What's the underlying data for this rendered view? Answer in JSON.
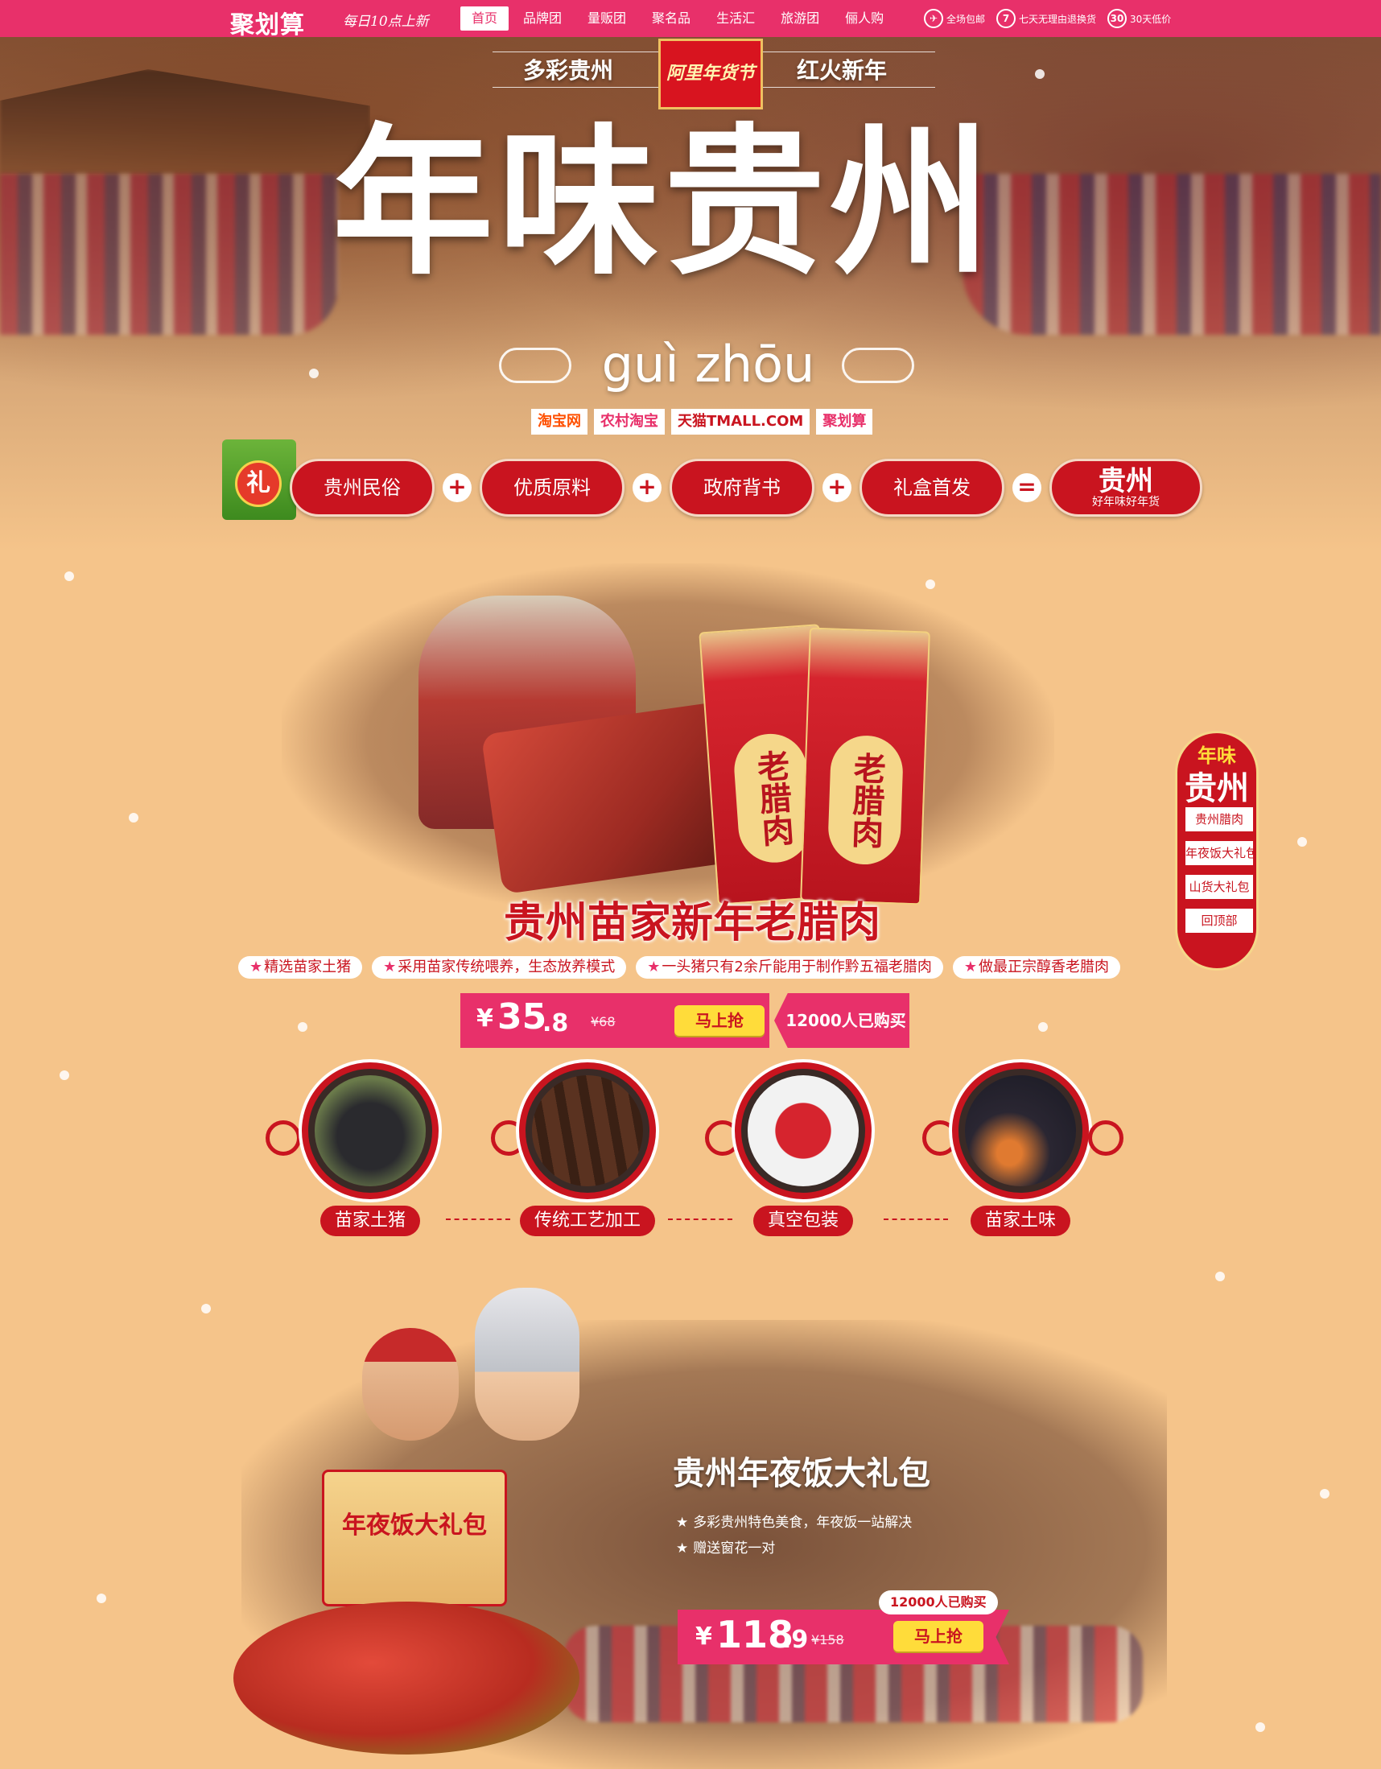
{
  "topbar": {
    "logo": "聚划算",
    "slogan": "每日10点上新",
    "nav": [
      "首页",
      "品牌团",
      "量贩团",
      "聚名品",
      "生活汇",
      "旅游团",
      "俪人购"
    ],
    "guarantees": [
      {
        "icon": "shipping-icon",
        "label": "全场包邮",
        "glyph": "✈"
      },
      {
        "icon": "seven-day-icon",
        "label": "七天无理由退换货",
        "glyph": "7"
      },
      {
        "icon": "thirty-day-icon",
        "label": "30天低价",
        "glyph": "30"
      }
    ]
  },
  "hero": {
    "subtitle_left": "多彩贵州",
    "badge": "阿里年货节",
    "subtitle_right": "红火新年",
    "title": "年味贵州",
    "pinyin": "guì zhōu",
    "platforms": [
      {
        "label": "淘宝网",
        "color": "#ff5000"
      },
      {
        "label": "农村淘宝",
        "color": "#e8306a"
      },
      {
        "label": "天猫TMALL.COM",
        "color": "#c9141f"
      },
      {
        "label": "聚划算",
        "color": "#e8306a"
      }
    ]
  },
  "features": {
    "gift_char": "礼",
    "items": [
      "贵州民俗",
      "优质原料",
      "政府背书",
      "礼盒首发"
    ],
    "result_title": "贵州",
    "result_sub": "好年味好年货"
  },
  "product1": {
    "pack_label": "老腊肉",
    "title": "贵州苗家新年老腊肉",
    "tags": [
      "精选苗家土猪",
      "采用苗家传统喂养，生态放养模式",
      "一头猪只有2余斤能用于制作黔五福老腊肉",
      "做最正宗醇香老腊肉"
    ],
    "price_yen": "¥",
    "price_int": "35",
    "price_dec": ".8",
    "price_orig": "¥68",
    "buy_label": "马上抢",
    "sold": "12000人已购买"
  },
  "process": {
    "steps": [
      "苗家土猪",
      "传统工艺加工",
      "真空包装",
      "苗家土味"
    ],
    "dashes": [
      "------",
      "------",
      "------"
    ]
  },
  "product2": {
    "box_text": "年夜饭大礼包",
    "title": "贵州年夜饭大礼包",
    "bullets": [
      "多彩贵州特色美食，年夜饭一站解决",
      "赠送窗花一对"
    ],
    "sold": "12000人已购买",
    "price_yen": "¥",
    "price_int": "118",
    "price_dec": ".9",
    "price_orig": "¥158",
    "buy_label": "马上抢"
  },
  "sidenav": {
    "top": "年味",
    "big": "贵州",
    "items": [
      "贵州腊肉",
      "年夜饭大礼包",
      "山货大礼包",
      "回顶部"
    ]
  },
  "colors": {
    "brand_pink": "#e8306a",
    "festive_red": "#c9141f",
    "gold": "#ffdc3a",
    "page_bg": "#f5c48a"
  }
}
